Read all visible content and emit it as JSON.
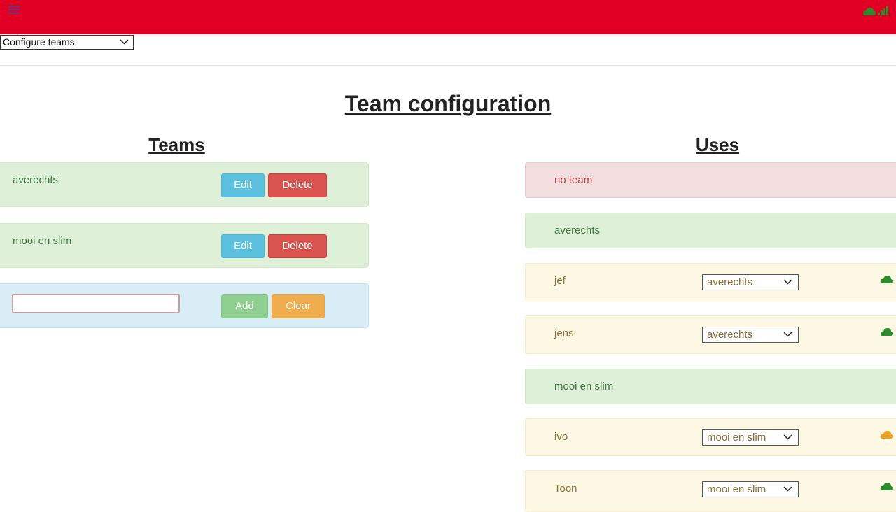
{
  "colors": {
    "topbar": "#e10024",
    "cloud_ok": "#2e8b2e",
    "cloud_warn": "#f0a020"
  },
  "nav": {
    "menu_icon": "hamburger-icon",
    "status_icons": [
      "cloud-icon",
      "signal-icon"
    ]
  },
  "mode_select": {
    "value": "Configure teams"
  },
  "page": {
    "title": "Team configuration"
  },
  "teams": {
    "title": "Teams",
    "items": [
      {
        "name": "averechts",
        "edit_label": "Edit",
        "delete_label": "Delete"
      },
      {
        "name": "mooi en slim",
        "edit_label": "Edit",
        "delete_label": "Delete"
      }
    ],
    "new_team": {
      "value": "",
      "add_label": "Add",
      "clear_label": "Clear"
    }
  },
  "uses": {
    "title": "Uses",
    "rows": [
      {
        "kind": "group",
        "status": "danger",
        "label": "no team"
      },
      {
        "kind": "group",
        "status": "success",
        "label": "averechts"
      },
      {
        "kind": "member",
        "status": "warning",
        "label": "jef",
        "team": "averechts",
        "cloud": "ok"
      },
      {
        "kind": "member",
        "status": "warning",
        "label": "jens",
        "team": "averechts",
        "cloud": "ok"
      },
      {
        "kind": "group",
        "status": "success",
        "label": "mooi en slim"
      },
      {
        "kind": "member",
        "status": "warning",
        "label": "ivo",
        "team": "mooi en slim",
        "cloud": "warn"
      },
      {
        "kind": "member",
        "status": "warning",
        "label": "Toon",
        "team": "mooi en slim",
        "cloud": "ok"
      }
    ]
  }
}
